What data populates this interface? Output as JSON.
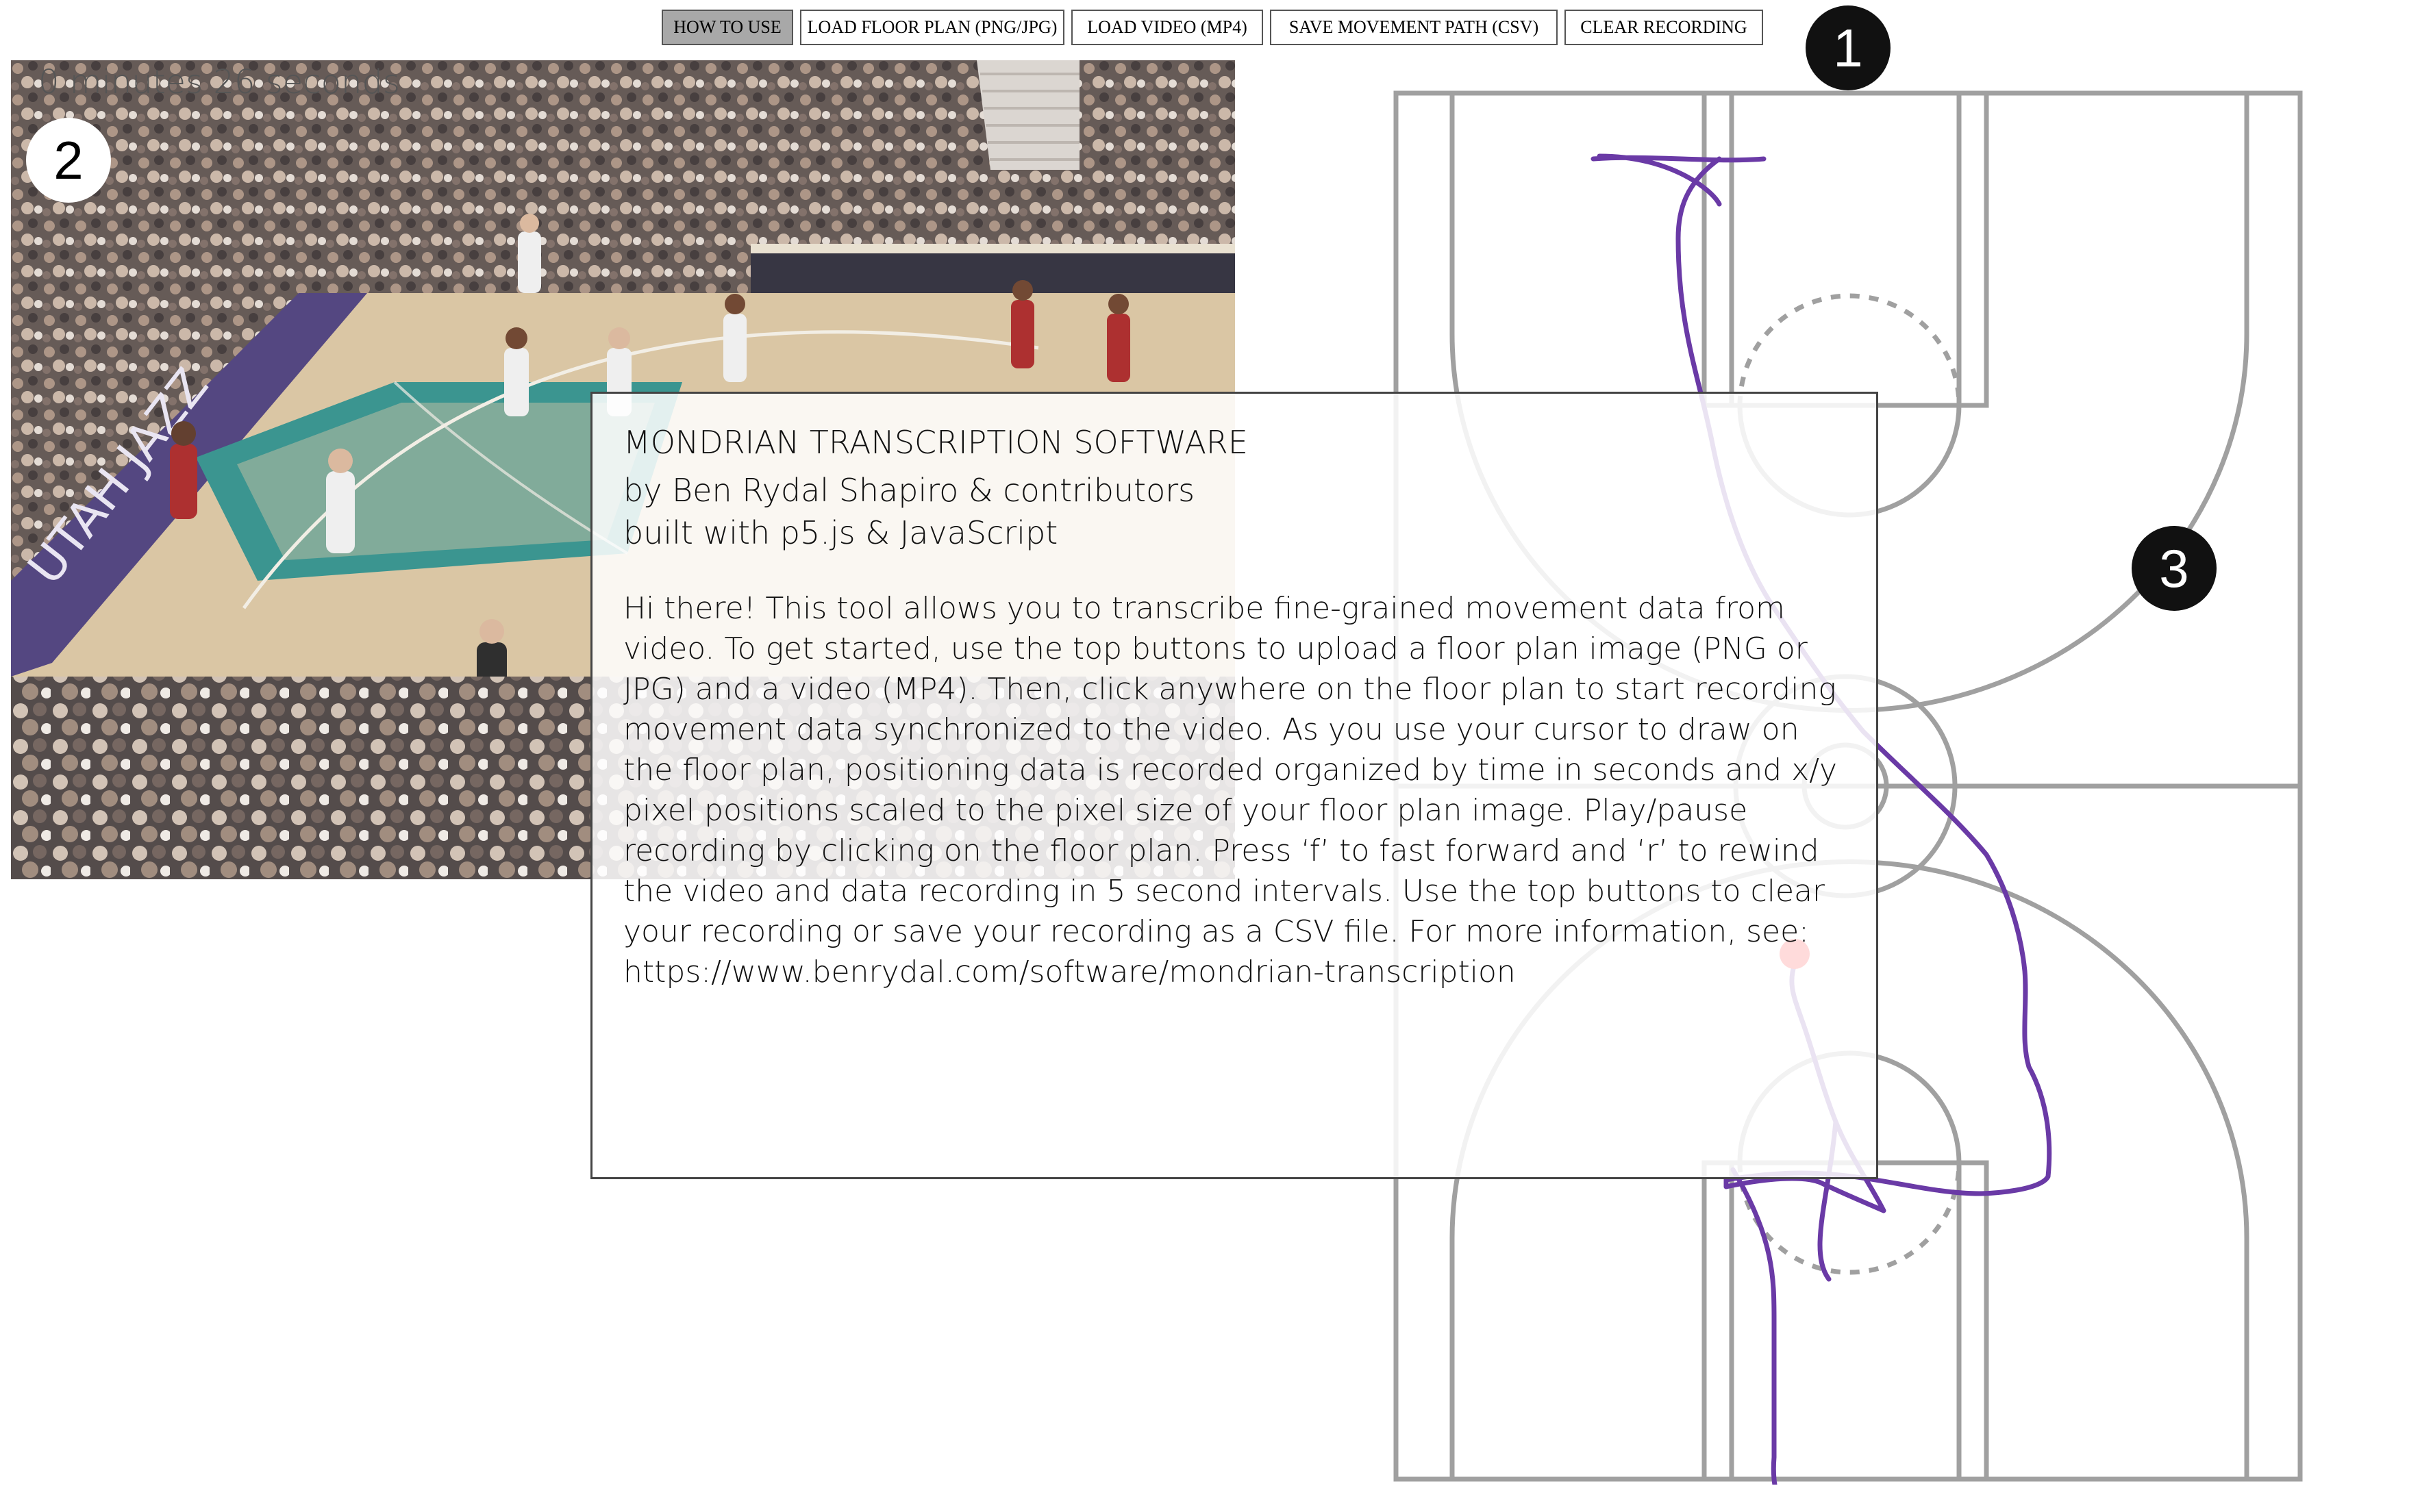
{
  "toolbar": {
    "buttons": [
      {
        "label": "HOW TO USE",
        "active": true
      },
      {
        "label": "LOAD FLOOR PLAN (PNG/JPG)",
        "active": false
      },
      {
        "label": "LOAD VIDEO (MP4)",
        "active": false
      },
      {
        "label": "SAVE MOVEMENT PATH (CSV)",
        "active": false
      },
      {
        "label": "CLEAR RECORDING",
        "active": false
      }
    ]
  },
  "markers": {
    "toolbar": "1",
    "video": "2",
    "floorplan": "3"
  },
  "video": {
    "time_label": "0 minutes  26 seconds"
  },
  "dialog": {
    "title": "MONDRIAN TRANSCRIPTION SOFTWARE",
    "author": "by Ben Rydal Shapiro & contributors",
    "built_with": "built with p5.js & JavaScript",
    "body": "Hi there! This tool allows you to transcribe fine-grained movement data from video. To get started, use the top buttons to upload a floor plan image (PNG or JPG) and a video (MP4). Then, click anywhere on the floor plan to start recording movement data synchronized to the video. As you use your cursor to draw on the floor plan, positioning data is recorded organized by time in seconds and x/y pixel positions scaled to the pixel size of your floor plan image. Play/pause recording by clicking on the floor plan. Press ‘f’ to fast forward and ‘r’ to rewind the video and data recording in 5 second intervals. Use the top buttons to clear your recording or save your recording as a CSV file. For more information, see: https://www.benrydal.com/software/mondrian-transcription"
  },
  "colors": {
    "path": "#6a3aa6",
    "cursor_dot": "#ff0000",
    "court_lines": "#a0a0a0",
    "active_button": "#a8a8a8"
  }
}
